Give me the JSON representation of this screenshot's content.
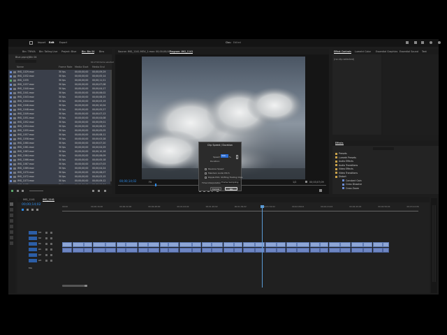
{
  "app": {
    "menu": [
      "Import",
      "Edit",
      "Export"
    ],
    "active_menu": "Edit",
    "project_title": "Clou",
    "project_status": "Edited"
  },
  "project_panel": {
    "tabs": [
      "Bin: TRIVIA",
      "Bin: Tailing Live",
      "Project: Blue",
      "Bin: Bin 04",
      "Bins"
    ],
    "active_tab": "Bin: Bin 04",
    "path": "Blue.prproj\\Bin 04",
    "count": "60 of 60 items selected",
    "columns": [
      "Name",
      "Frame Rate",
      "Media Start",
      "Media End"
    ],
    "rows": [
      {
        "name": "IMG_1029.mov",
        "fps": "30 fps",
        "start": "00;00;00;00",
        "end": "00;00;09;29"
      },
      {
        "name": "IMG_1032.mov",
        "fps": "30 fps",
        "start": "00;00;00;00",
        "end": "00;00;05;14"
      },
      {
        "name": "IMG_1035",
        "fps": "30 fps",
        "start": "00;00;00;00",
        "end": "00;00;11;21"
      },
      {
        "name": "IMG_1037.mov",
        "fps": "30 fps",
        "start": "00;00;00;00",
        "end": "00;00;07;08"
      },
      {
        "name": "IMG_1040.mov",
        "fps": "30 fps",
        "start": "00;00;00;00",
        "end": "00;00;04;17"
      },
      {
        "name": "IMG_1041.mov",
        "fps": "30 fps",
        "start": "00;00;00;00",
        "end": "00;00;06;02"
      },
      {
        "name": "IMG_1043.mov",
        "fps": "30 fps",
        "start": "00;00;00;00",
        "end": "00;00;08;25"
      },
      {
        "name": "IMG_1044.mov",
        "fps": "30 fps",
        "start": "00;00;00;00",
        "end": "00;00;03;19"
      },
      {
        "name": "IMG_1046.mov",
        "fps": "30 fps",
        "start": "00;00;00;00",
        "end": "00;00;10;04"
      },
      {
        "name": "IMG_1048.mov",
        "fps": "30 fps",
        "start": "00;00;00;00",
        "end": "00;00;05;27"
      },
      {
        "name": "IMG_1049.mov",
        "fps": "30 fps",
        "start": "00;00;00;00",
        "end": "00;00;07;13"
      },
      {
        "name": "IMG_1051.mov",
        "fps": "30 fps",
        "start": "00;00;00;00",
        "end": "00;00;04;08"
      },
      {
        "name": "IMG_1052.mov",
        "fps": "30 fps",
        "start": "00;00;00;00",
        "end": "00;00;09;01"
      },
      {
        "name": "IMG_1054.mov",
        "fps": "30 fps",
        "start": "00;00;00;00",
        "end": "00;00;06;22"
      },
      {
        "name": "IMG_1055.mov",
        "fps": "30 fps",
        "start": "00;00;00;00",
        "end": "00;00;05;05"
      },
      {
        "name": "IMG_1057.mov",
        "fps": "30 fps",
        "start": "00;00;00;00",
        "end": "00;00;08;11"
      },
      {
        "name": "IMG_1058.mov",
        "fps": "30 fps",
        "start": "00;00;00;00",
        "end": "00;00;03;28"
      },
      {
        "name": "IMG_1060.mov",
        "fps": "30 fps",
        "start": "00;00;00;00",
        "end": "00;00;07;20"
      },
      {
        "name": "IMG_1061.mov",
        "fps": "30 fps",
        "start": "00;00;00;00",
        "end": "00;00;04;29"
      },
      {
        "name": "IMG_1063.mov",
        "fps": "30 fps",
        "start": "00;00;00;00",
        "end": "00;00;10;16"
      },
      {
        "name": "IMG_1064.mov",
        "fps": "30 fps",
        "start": "00;00;00;00",
        "end": "00;00;06;09"
      },
      {
        "name": "IMG_1066.mov",
        "fps": "30 fps",
        "start": "00;00;00;00",
        "end": "00;00;05;18"
      },
      {
        "name": "IMG_1067.mov",
        "fps": "30 fps",
        "start": "00;00;00;00",
        "end": "00;00;07;03"
      },
      {
        "name": "IMG_1069.mov",
        "fps": "30 fps",
        "start": "00;00;00;00",
        "end": "00;00;04;24"
      },
      {
        "name": "IMG_1070.mov",
        "fps": "30 fps",
        "start": "00;00;00;00",
        "end": "00;00;08;07"
      },
      {
        "name": "IMG_1072.mov",
        "fps": "30 fps",
        "start": "00;00;00;00",
        "end": "00;00;03;15"
      },
      {
        "name": "IMG_1073.mov",
        "fps": "30 fps",
        "start": "00;00;00;00",
        "end": "00;00;09;12"
      },
      {
        "name": "IMG_1075.mov",
        "fps": "30 fps",
        "start": "00;00;00;00",
        "end": "00;00;06;26"
      }
    ]
  },
  "program_monitor": {
    "tabs": [
      "Source: IMG_1141.MOV_1.mov: 00;00;00;00",
      "Program: IMG_1141"
    ],
    "active_tab": "Program: IMG_1141",
    "timecode_left": "00;00;14;02",
    "fit": "Fit",
    "ratio": "1/2",
    "timecode_right": "00;03;07;09"
  },
  "right_panel": {
    "tabs": [
      "Effect Controls",
      "Lumetri Color",
      "Essential Graphics",
      "Essential Sound",
      "Text"
    ],
    "active_tab": "Effect Controls",
    "no_clip": "(no clip selected)"
  },
  "effects_panel": {
    "title": "Effects",
    "items": [
      {
        "label": "Presets",
        "folder": true
      },
      {
        "label": "Lumetri Presets",
        "folder": true
      },
      {
        "label": "Audio Effects",
        "folder": true
      },
      {
        "label": "Audio Transitions",
        "folder": true
      },
      {
        "label": "Video Effects",
        "folder": true
      },
      {
        "label": "Video Transitions",
        "folder": true
      },
      {
        "label": "Distort",
        "folder": true
      },
      {
        "label": "Constant Gain",
        "folder": false
      },
      {
        "label": "Cross Dissolve",
        "folder": false
      },
      {
        "label": "Cross Zoom",
        "folder": false
      }
    ]
  },
  "dialog": {
    "title": "Clip Speed / Duration",
    "speed_label": "Speed:",
    "speed_value": "300",
    "speed_unit": "%",
    "duration_label": "Duration:",
    "reverse_label": "Reverse Speed",
    "maintain_label": "Maintain Audio Pitch",
    "ripple_label": "Ripple Edit, Shifting Trailing Clips",
    "interp_label": "Time Interpolation:",
    "interp_value": "Frame Sampling",
    "cancel": "Cancel",
    "ok": "OK"
  },
  "timeline": {
    "tabs": [
      "IMG_1141",
      "IMG_1141"
    ],
    "active_tab": "IMG_1141",
    "timecode": "00;00;14;02",
    "ruler": [
      "00;00",
      "00;00;16;00",
      "00;00;32;00",
      "00;00;48;00",
      "00;01;04;02",
      "00;01;20;02",
      "00;01;36;02",
      "00;01;52;02",
      "00;02;08;04",
      "00;02;24;04",
      "00;02;40;04",
      "00;02;56;04",
      "00;03;12;06"
    ],
    "tracks": [
      {
        "label": "V3"
      },
      {
        "label": "V2"
      },
      {
        "label": "V1"
      },
      {
        "label": "A1"
      },
      {
        "label": "A2"
      },
      {
        "label": "A3"
      }
    ],
    "master": "Mix"
  },
  "colors": {
    "label_blue": "#6b8bd1",
    "label_green": "#5aa86a",
    "video_clip": "#8ea6d6",
    "audio_clip": "#6d85c2",
    "playhead": "#5b9bd5",
    "accent_blue": "#2d8ceb"
  }
}
